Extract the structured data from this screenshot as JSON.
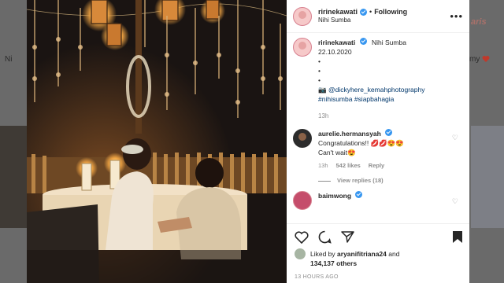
{
  "backdrop": {
    "left_text": "Ni",
    "right_text": "my",
    "brand_text": "aris"
  },
  "post": {
    "username": "ririnekawati",
    "follow_label": "Following",
    "location": "Nihi Sumba",
    "more_label": "•••"
  },
  "caption": {
    "username": "ririnekawati",
    "location": "Nihi Sumba",
    "date": "22.10.2020",
    "dot1": "•",
    "dot2": "•",
    "dot3": "•",
    "credit": "📷 @dickyhere_kemahphotography",
    "hashtags": "#nihisumba #siapbahagia",
    "age": "13h"
  },
  "comments": [
    {
      "username": "aurelie.hermansyah",
      "text_line1": "Congratulations!! 💋💋😍😍",
      "text_line2": "Can't wait😍",
      "age": "13h",
      "likes": "542 likes",
      "reply_label": "Reply",
      "replies_label": "View replies (18)"
    },
    {
      "username": "baimwong"
    }
  ],
  "footer": {
    "liked_prefix": "Liked by",
    "liked_user": "aryanifitriana24",
    "liked_and": "and",
    "others": "134,137 others",
    "timestamp": "13 HOURS AGO"
  },
  "colors": {
    "verified": "#3897f0",
    "link": "#00376b",
    "muted": "#8e8e8e",
    "text": "#262626"
  }
}
